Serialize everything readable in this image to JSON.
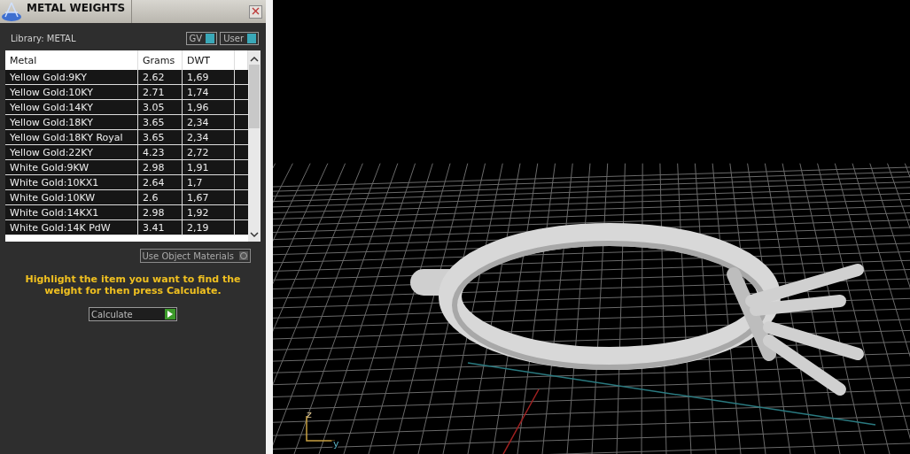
{
  "panel": {
    "title": "METAL WEIGHTS",
    "library": "Library: METAL",
    "toggles": [
      {
        "label": "GV",
        "on": true
      },
      {
        "label": "User",
        "on": true
      }
    ],
    "table": {
      "columns": [
        "Metal",
        "Grams",
        "DWT"
      ],
      "rows": [
        [
          "Yellow Gold:9KY",
          "2.62",
          "1,69"
        ],
        [
          "Yellow Gold:10KY",
          "2.71",
          "1,74"
        ],
        [
          "Yellow Gold:14KY",
          "3.05",
          "1,96"
        ],
        [
          "Yellow Gold:18KY",
          "3.65",
          "2,34"
        ],
        [
          "Yellow Gold:18KY Royal",
          "3.65",
          "2,34"
        ],
        [
          "Yellow Gold:22KY",
          "4.23",
          "2,72"
        ],
        [
          "White Gold:9KW",
          "2.98",
          "1,91"
        ],
        [
          "White Gold:10KX1",
          "2.64",
          "1,7"
        ],
        [
          "White Gold:10KW",
          "2.6",
          "1,67"
        ],
        [
          "White Gold:14KX1",
          "2.98",
          "1,92"
        ],
        [
          "White Gold:14K PdW",
          "3.41",
          "2,19"
        ]
      ]
    },
    "option": {
      "label": "Use Object Materials",
      "checked": false
    },
    "hint": "Highlight the item you want to find the weight for then press Calculate.",
    "button": "Calculate"
  },
  "viewport": {
    "axes": [
      "z",
      "y"
    ]
  }
}
